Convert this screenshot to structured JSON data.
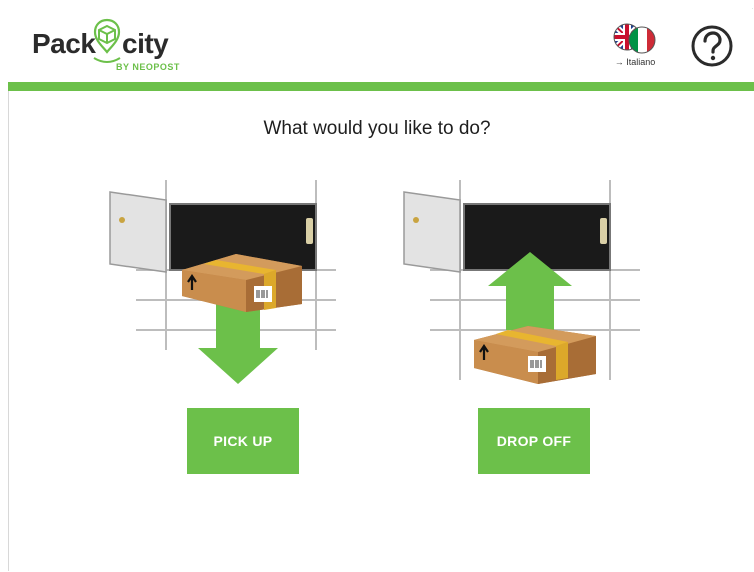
{
  "brand": {
    "name_left": "Pack",
    "name_right": "city",
    "tagline": "BY NEOPOST",
    "accent_color": "#6cc04a"
  },
  "header": {
    "language_icon": "uk-italy-flags-icon",
    "language_label": "→ Italiano",
    "help_icon": "question-mark-icon"
  },
  "main": {
    "question": "What would you like to do?",
    "options": [
      {
        "label": "PICK UP",
        "illustration": "box-out-of-locker-arrow-down"
      },
      {
        "label": "DROP OFF",
        "illustration": "box-into-locker-arrow-up"
      }
    ]
  }
}
